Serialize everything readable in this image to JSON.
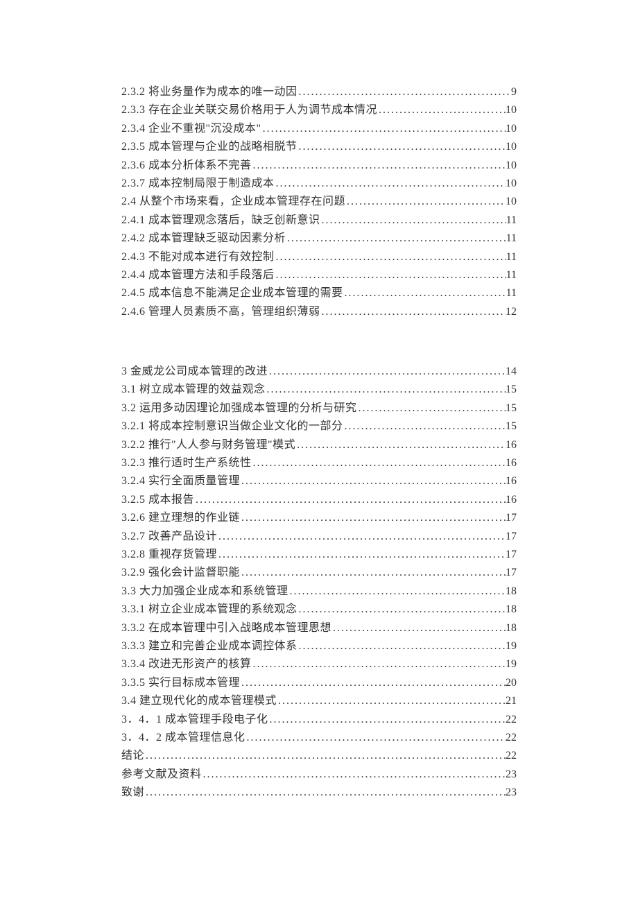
{
  "toc": {
    "block1": [
      {
        "label": "2.3.2 将业务量作为成本的唯一动因",
        "page": "9"
      },
      {
        "label": "2.3.3 存在企业关联交易价格用于人为调节成本情况",
        "page": "10"
      },
      {
        "label": "2.3.4 企业不重视\"沉没成本\"",
        "page": "10"
      },
      {
        "label": "2.3.5 成本管理与企业的战略相脱节",
        "page": "10"
      },
      {
        "label": "2.3.6 成本分析体系不完善",
        "page": "10"
      },
      {
        "label": "2.3.7 成本控制局限于制造成本",
        "page": "10"
      },
      {
        "label": "2.4 从整个市场来看，企业成本管理存在问题",
        "page": "10"
      },
      {
        "label": "2.4.1 成本管理观念落后，缺乏创新意识",
        "page": "11"
      },
      {
        "label": "2.4.2 成本管理缺乏驱动因素分析",
        "page": "11"
      },
      {
        "label": "2.4.3 不能对成本进行有效控制",
        "page": "11"
      },
      {
        "label": "2.4.4 成本管理方法和手段落后",
        "page": "11"
      },
      {
        "label": "2.4.5 成本信息不能满足企业成本管理的需要",
        "page": "11"
      },
      {
        "label": "2.4.6 管理人员素质不高，管理组织薄弱",
        "page": "12"
      }
    ],
    "block2": [
      {
        "label": "3 金威龙公司成本管理的改进",
        "page": "14"
      },
      {
        "label": "3.1 树立成本管理的效益观念",
        "page": "15"
      },
      {
        "label": "3.2 运用多动因理论加强成本管理的分析与研究",
        "page": "15"
      },
      {
        "label": "3.2.1 将成本控制意识当做企业文化的一部分",
        "page": "15"
      },
      {
        "label": "3.2.2 推行\"人人参与财务管理\"模式",
        "page": "16"
      },
      {
        "label": "3.2.3 推行适时生产系统性",
        "page": "16"
      },
      {
        "label": "3.2.4 实行全面质量管理",
        "page": "16"
      },
      {
        "label": "3.2.5 成本报告",
        "page": "16"
      },
      {
        "label": "3.2.6 建立理想的作业链",
        "page": "17"
      },
      {
        "label": "3.2.7 改善产品设计",
        "page": "17"
      },
      {
        "label": "3.2.8 重视存货管理",
        "page": "17"
      },
      {
        "label": "3.2.9 强化会计监督职能",
        "page": "17"
      },
      {
        "label": "3.3 大力加强企业成本和系统管理",
        "page": "18"
      },
      {
        "label": "3.3.1 树立企业成本管理的系统观念",
        "page": "18"
      },
      {
        "label": "3.3.2 在成本管理中引入战略成本管理思想",
        "page": "18"
      },
      {
        "label": "3.3.3 建立和完善企业成本调控体系",
        "page": "19"
      },
      {
        "label": "3.3.4 改进无形资产的核算",
        "page": "19"
      },
      {
        "label": "3.3.5 实行目标成本管理",
        "page": "20"
      },
      {
        "label": "3.4 建立现代化的成本管理模式",
        "page": "21"
      },
      {
        "label": "3．4．1 成本管理手段电子化",
        "page": "22"
      },
      {
        "label": "3．4．2 成本管理信息化",
        "page": "22"
      },
      {
        "label": "结论",
        "page": "22"
      },
      {
        "label": "参考文献及资料",
        "page": "23"
      },
      {
        "label": "致谢",
        "page": "23"
      }
    ]
  }
}
